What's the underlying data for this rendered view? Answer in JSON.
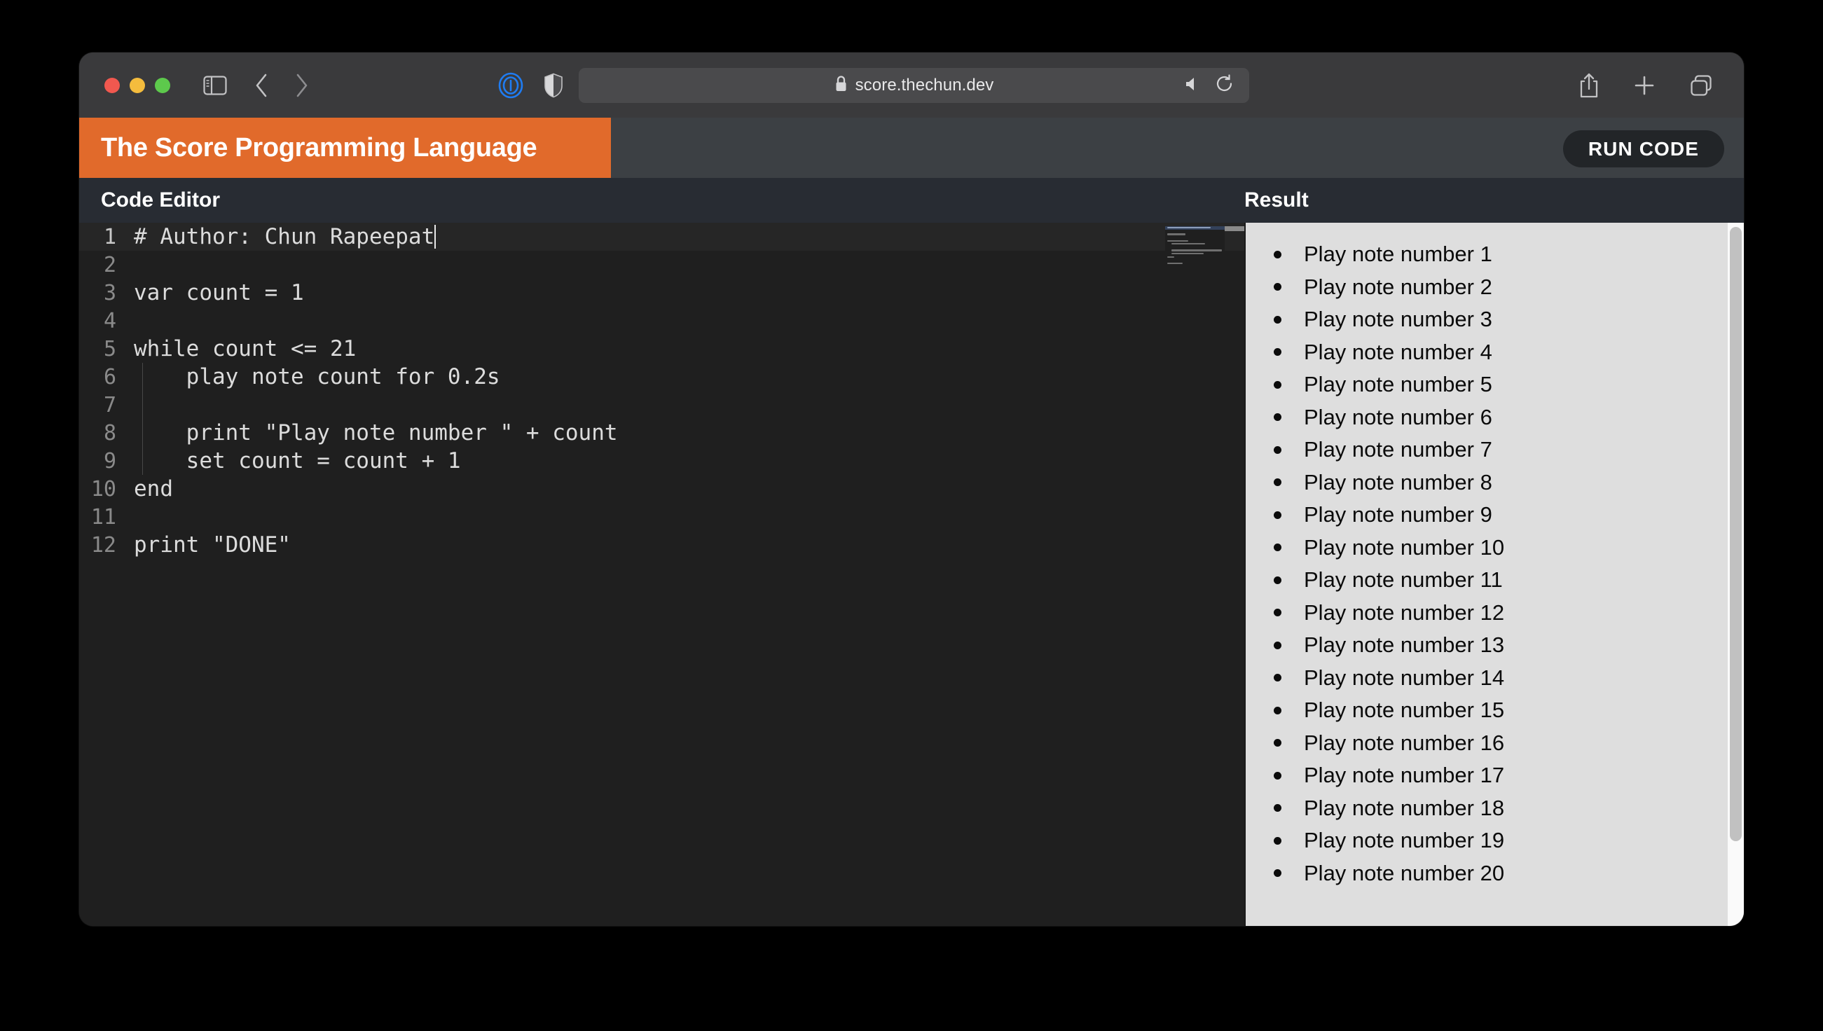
{
  "browser": {
    "traffic_lights": [
      "close",
      "minimize",
      "maximize"
    ],
    "url": "score.thechun.dev",
    "toolbar_icons": [
      "sidebar-toggle-icon",
      "back-arrow-icon",
      "forward-arrow-icon",
      "onepassword-icon",
      "shield-icon",
      "lock-icon",
      "speaker-icon",
      "reload-icon",
      "share-icon",
      "new-tab-icon",
      "tab-overview-icon"
    ]
  },
  "app": {
    "title": "The Score Programming Language",
    "run_button_label": "RUN CODE",
    "brand_orange": "#e16a2b",
    "header_bg": "#3c4044"
  },
  "panels": {
    "editor_title": "Code Editor",
    "result_title": "Result"
  },
  "editor": {
    "active_line": 1,
    "cursor_line": 1,
    "lines": [
      {
        "n": "1",
        "text": "# Author: Chun Rapeepat",
        "indent": false
      },
      {
        "n": "2",
        "text": "",
        "indent": false
      },
      {
        "n": "3",
        "text": "var count = 1",
        "indent": false
      },
      {
        "n": "4",
        "text": "",
        "indent": false
      },
      {
        "n": "5",
        "text": "while count <= 21",
        "indent": false
      },
      {
        "n": "6",
        "text": "    play note count for 0.2s",
        "indent": true
      },
      {
        "n": "7",
        "text": "",
        "indent": true
      },
      {
        "n": "8",
        "text": "    print \"Play note number \" + count",
        "indent": true
      },
      {
        "n": "9",
        "text": "    set count = count + 1",
        "indent": true
      },
      {
        "n": "10",
        "text": "end",
        "indent": false
      },
      {
        "n": "11",
        "text": "",
        "indent": false
      },
      {
        "n": "12",
        "text": "print \"DONE\"",
        "indent": false
      }
    ],
    "minimap_widths": [
      62,
      0,
      26,
      0,
      30,
      48,
      0,
      72,
      46,
      10,
      0,
      22
    ]
  },
  "result": {
    "items": [
      "Play note number 1",
      "Play note number 2",
      "Play note number 3",
      "Play note number 4",
      "Play note number 5",
      "Play note number 6",
      "Play note number 7",
      "Play note number 8",
      "Play note number 9",
      "Play note number 10",
      "Play note number 11",
      "Play note number 12",
      "Play note number 13",
      "Play note number 14",
      "Play note number 15",
      "Play note number 16",
      "Play note number 17",
      "Play note number 18",
      "Play note number 19",
      "Play note number 20"
    ]
  }
}
